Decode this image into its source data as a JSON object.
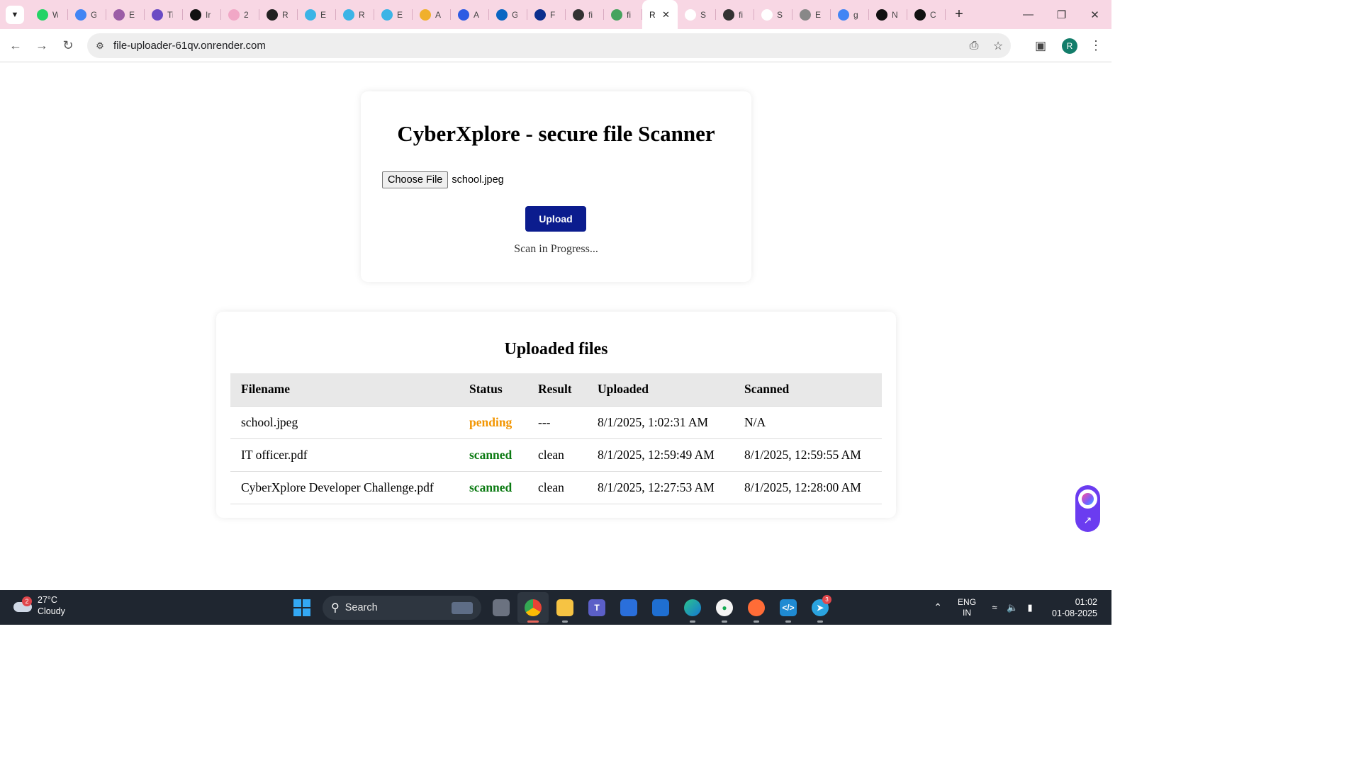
{
  "browser": {
    "tabs": [
      {
        "title": "W",
        "icon": "whatsapp-icon",
        "color": "#25d366"
      },
      {
        "title": "G",
        "icon": "google-maps-icon",
        "color": "#4285f4"
      },
      {
        "title": "El",
        "icon": "globe-icon",
        "color": "#9b5da6"
      },
      {
        "title": "Ti",
        "icon": "target-icon",
        "color": "#6a4bc4"
      },
      {
        "title": "Ir",
        "icon": "openai-icon",
        "color": "#111111"
      },
      {
        "title": "2",
        "icon": "spark-icon",
        "color": "#f1a7c6"
      },
      {
        "title": "R",
        "icon": "react-icon",
        "color": "#222222"
      },
      {
        "title": "E",
        "icon": "cloud-icon",
        "color": "#3cb4e6"
      },
      {
        "title": "R",
        "icon": "cloud-icon",
        "color": "#3cb4e6"
      },
      {
        "title": "E",
        "icon": "cloud-icon",
        "color": "#3cb4e6"
      },
      {
        "title": "A",
        "icon": "w-icon",
        "color": "#f0b02c"
      },
      {
        "title": "A",
        "icon": "k-icon",
        "color": "#2d5be3"
      },
      {
        "title": "G",
        "icon": "linkedin-icon",
        "color": "#0a66c2"
      },
      {
        "title": "F",
        "icon": "b-icon",
        "color": "#0b2f8e"
      },
      {
        "title": "fi",
        "icon": "github-icon",
        "color": "#333333"
      },
      {
        "title": "fi",
        "icon": "check-icon",
        "color": "#46a35e"
      },
      {
        "title": "R",
        "icon": "close-icon",
        "color": "#ffffff",
        "active": true
      },
      {
        "title": "S",
        "icon": "link-icon",
        "color": "#ffffff"
      },
      {
        "title": "fi",
        "icon": "github-icon",
        "color": "#333333"
      },
      {
        "title": "S",
        "icon": "link-icon",
        "color": "#ffffff"
      },
      {
        "title": "E",
        "icon": "globe-icon",
        "color": "#888888"
      },
      {
        "title": "g",
        "icon": "google-icon",
        "color": "#4285f4"
      },
      {
        "title": "N",
        "icon": "mongodb-icon",
        "color": "#111111"
      },
      {
        "title": "C",
        "icon": "mongodb-icon",
        "color": "#111111"
      }
    ],
    "url": "file-uploader-61qv.onrender.com",
    "profile_initial": "R"
  },
  "page": {
    "title": "CyberXplore - secure file Scanner",
    "choose_file_label": "Choose File",
    "selected_file": "school.jpeg",
    "upload_label": "Upload",
    "scan_status": "Scan in Progress...",
    "files_title": "Uploaded files",
    "columns": [
      "Filename",
      "Status",
      "Result",
      "Uploaded",
      "Scanned"
    ],
    "rows": [
      {
        "filename": "school.jpeg",
        "status": "pending",
        "result": "---",
        "uploaded": "8/1/2025, 1:02:31 AM",
        "scanned": "N/A"
      },
      {
        "filename": "IT officer.pdf",
        "status": "scanned",
        "result": "clean",
        "uploaded": "8/1/2025, 12:59:49 AM",
        "scanned": "8/1/2025, 12:59:55 AM"
      },
      {
        "filename": "CyberXplore Developer Challenge.pdf",
        "status": "scanned",
        "result": "clean",
        "uploaded": "8/1/2025, 12:27:53 AM",
        "scanned": "8/1/2025, 12:28:00 AM"
      }
    ],
    "colors": {
      "upload_button": "#0b1c8e",
      "pending": "#f29500",
      "scanned": "#0b7a12",
      "tab_strip": "#f8d7e4"
    }
  },
  "taskbar": {
    "weather_badge": "2",
    "temperature": "27°C",
    "condition": "Cloudy",
    "search_label": "Search",
    "telegram_badge": "3",
    "lang_line1": "ENG",
    "lang_line2": "IN",
    "time": "01:02",
    "date": "01-08-2025"
  }
}
